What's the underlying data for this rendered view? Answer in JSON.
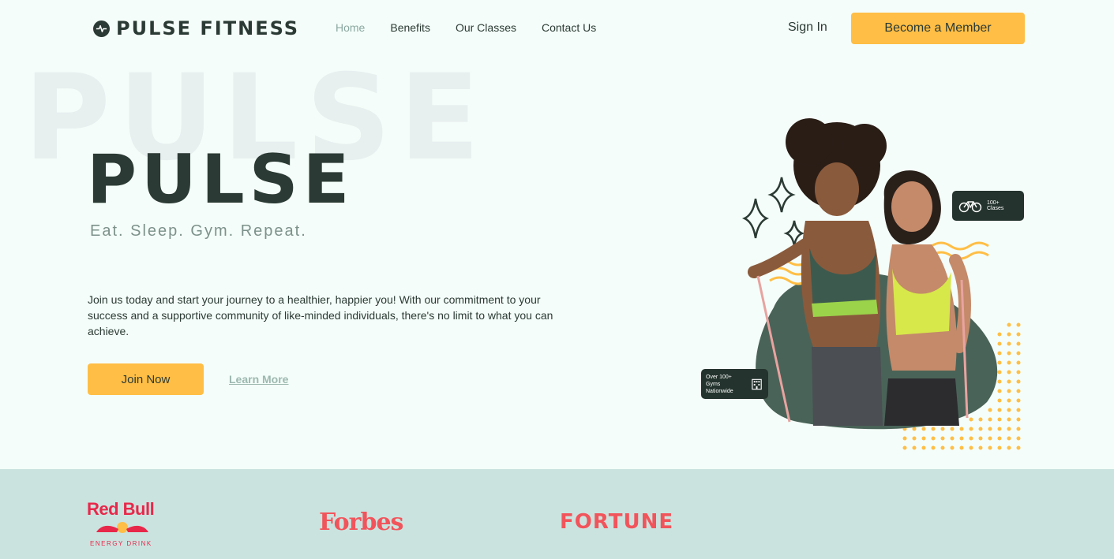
{
  "nav": {
    "brand": "PULSE FITNESS",
    "links": [
      "Home",
      "Benefits",
      "Our Classes",
      "Contact Us"
    ],
    "sign_in": "Sign In",
    "cta": "Become a Member"
  },
  "hero": {
    "ghost_word": "PULSE",
    "title": "PULSE",
    "tagline": "Eat. Sleep. Gym. Repeat.",
    "description": "Join us today and start your journey to a healthier, happier you! With our commitment to your success and a supportive community of like-minded individuals, there's no limit to what you can achieve.",
    "join_button": "Join Now",
    "learn_more": "Learn More",
    "badge_classes": "100+ Clases",
    "badge_gyms_line1": "Over 100+",
    "badge_gyms_line2": "Gyms Nationwide"
  },
  "partners": {
    "redbull": "Red Bull",
    "redbull_sub": "ENERGY DRINK",
    "forbes": "Forbes",
    "fortune": "FORTUNE"
  },
  "colors": {
    "accent": "#ffbe45",
    "dark": "#2b3a34",
    "background": "#f4fdf9",
    "partner_band": "#cbe3df",
    "logo_red": "#f2545b"
  },
  "icons": [
    "pulse-logo-icon",
    "bicycle-icon",
    "building-icon",
    "sparkle-icon",
    "bull-icon"
  ]
}
